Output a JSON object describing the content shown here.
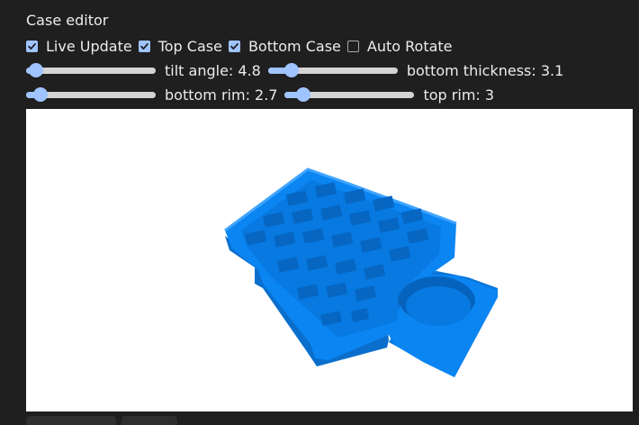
{
  "panel": {
    "title": "Case editor"
  },
  "checkboxes": [
    {
      "label": "Live Update",
      "checked": true
    },
    {
      "label": "Top Case",
      "checked": true
    },
    {
      "label": "Bottom Case",
      "checked": true
    },
    {
      "label": "Auto Rotate",
      "checked": false
    }
  ],
  "sliders": {
    "tilt_angle": {
      "label": "tilt angle: 4.8",
      "fraction": 0.02
    },
    "bottom_thickness": {
      "label": "bottom thickness: 3.1",
      "fraction": 0.14
    },
    "bottom_rim": {
      "label": "bottom rim: 2.7",
      "fraction": 0.06
    },
    "top_rim": {
      "label": "top rim: 3",
      "fraction": 0.1
    }
  },
  "colors": {
    "accent": "#9fc4ff",
    "model": "#0a85f2",
    "background": "#1f1f1f",
    "viewport": "#ffffff"
  },
  "viewport": {
    "model": "keyboard-case-3d-model"
  }
}
